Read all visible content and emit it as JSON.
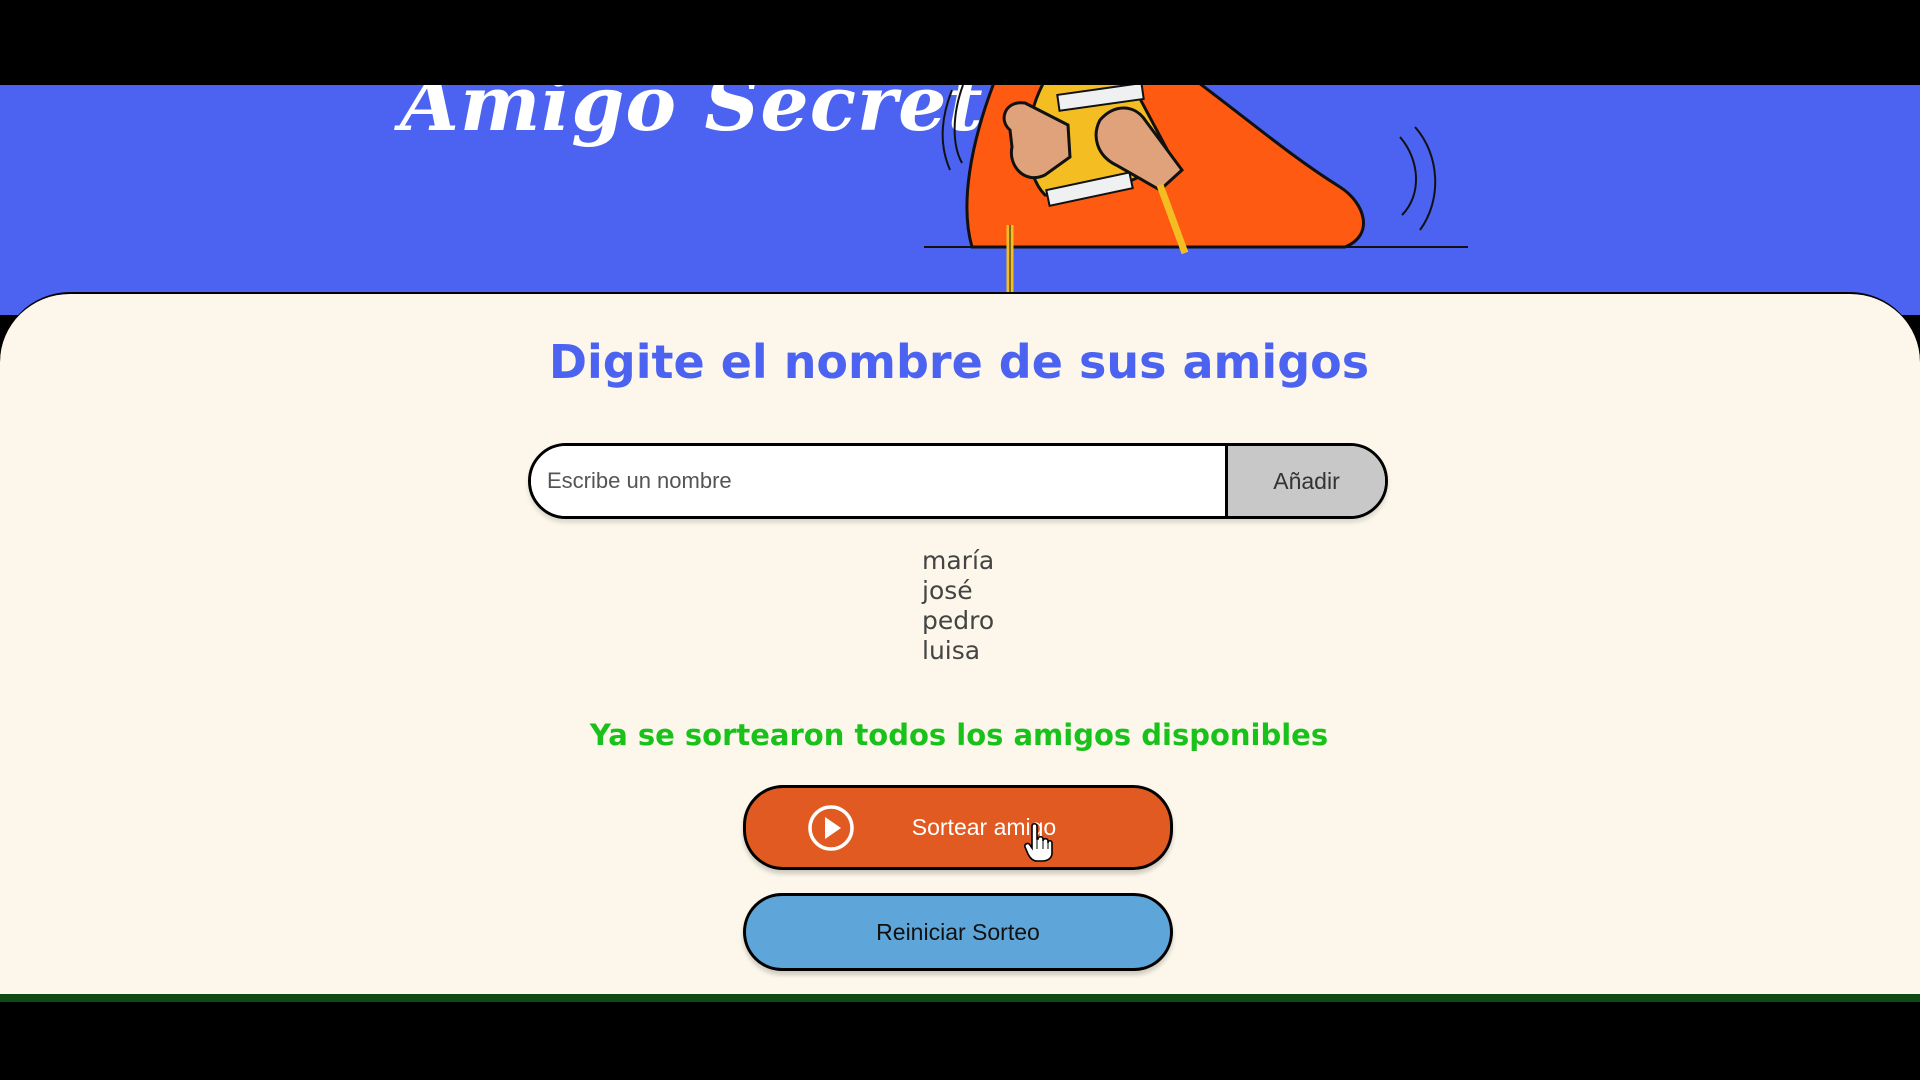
{
  "header": {
    "title": "Amigo Secreto"
  },
  "main": {
    "heading": "Digite el nombre de sus amigos",
    "input": {
      "placeholder": "Escribe un nombre",
      "value": ""
    },
    "add_button_label": "Añadir",
    "friends": [
      "maría",
      "josé",
      "pedro",
      "luisa"
    ],
    "result_message": "Ya se sortearon todos los amigos disponibles",
    "draw_button_label": "Sortear amigo",
    "reset_button_label": "Reiniciar Sorteo"
  },
  "icons": {
    "draw": "play-circle-icon",
    "cursor": "hand-pointer-icon"
  },
  "colors": {
    "header_bg": "#4b63f0",
    "card_bg": "#fcf7ea",
    "heading": "#4b63f0",
    "result_message": "#18c21a",
    "draw_button": "#e05a22",
    "reset_button": "#5ea5d9",
    "add_button": "#c8c8c8"
  }
}
